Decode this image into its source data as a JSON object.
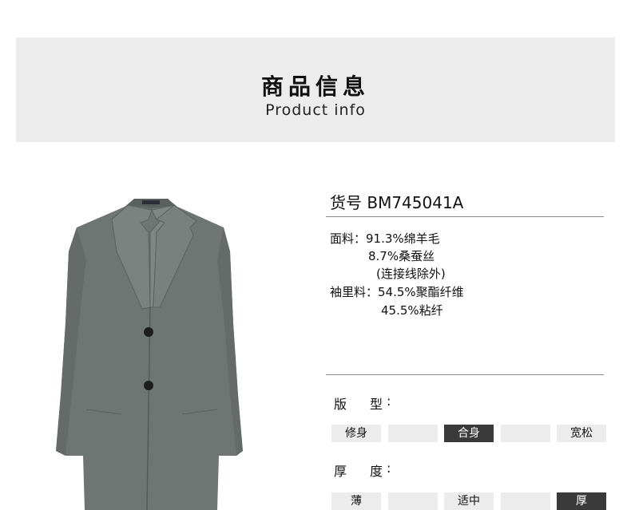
{
  "header": {
    "title_zh": "商品信息",
    "title_en": "Product info"
  },
  "product": {
    "sku_label": "货号",
    "sku": "BM745041A",
    "fabric_label": "面料：",
    "fabric_lines": [
      "91.3%绵羊毛",
      "8.7%桑蚕丝",
      "(连接线除外)"
    ],
    "lining_label": "袖里料：",
    "lining_lines": [
      "54.5%聚酯纤维",
      "45.5%粘纤"
    ]
  },
  "attributes": [
    {
      "label_a": "版",
      "label_b": "型",
      "options": [
        "修身",
        "",
        "合身",
        "",
        "宽松"
      ],
      "selected_index": 2
    },
    {
      "label_a": "厚",
      "label_b": "度",
      "options": [
        "薄",
        "",
        "适中",
        "",
        "厚"
      ],
      "selected_index": 4
    }
  ],
  "colors": {
    "banner_bg": "#ececec",
    "selected_bg": "#3a3a3a",
    "option_bg": "#ececec",
    "coat": "#6f7572"
  }
}
